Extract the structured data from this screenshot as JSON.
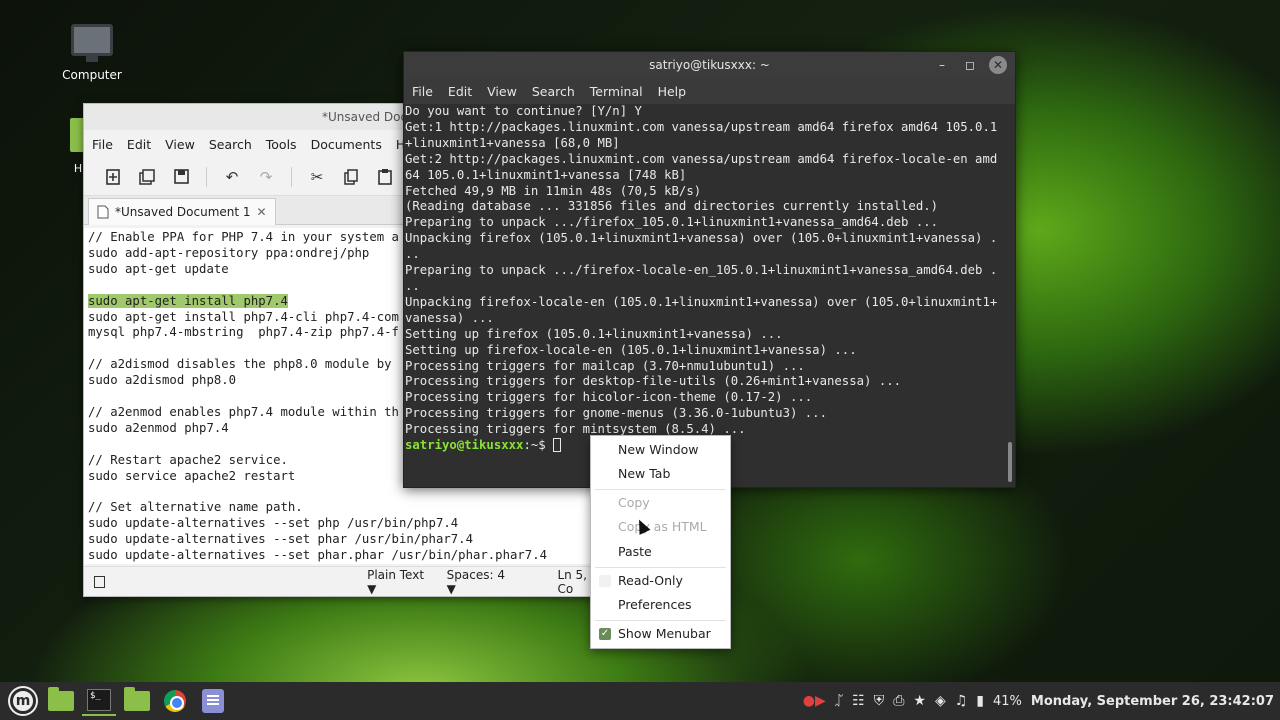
{
  "desktop": {
    "icons": [
      {
        "label": "Computer"
      },
      {
        "label": "H"
      }
    ]
  },
  "editor": {
    "title": "*Unsaved Doc",
    "menu": [
      "File",
      "Edit",
      "View",
      "Search",
      "Tools",
      "Documents",
      "Help"
    ],
    "tab_label": "*Unsaved Document 1",
    "lines": [
      "// Enable PPA for PHP 7.4 in your system a",
      "sudo add-apt-repository ppa:ondrej/php",
      "sudo apt-get update",
      "",
      "sudo apt-get install php7.4",
      "sudo apt-get install php7.4-cli php7.4-com",
      "mysql php7.4-mbstring  php7.4-zip php7.4-f",
      "",
      "// a2dismod disables the php8.0 module by",
      "sudo a2dismod php8.0",
      "",
      "// a2enmod enables php7.4 module within th",
      "sudo a2enmod php7.4",
      "",
      "// Restart apache2 service.",
      "sudo service apache2 restart",
      "",
      "// Set alternative name path.",
      "sudo update-alternatives --set php /usr/bin/php7.4",
      "sudo update-alternatives --set phar /usr/bin/phar7.4",
      "sudo update-alternatives --set phar.phar /usr/bin/phar.phar7.4"
    ],
    "highlighted_line": 4,
    "status": {
      "language": "Plain Text",
      "spaces": "Spaces: 4",
      "position": "Ln 5, Co"
    }
  },
  "terminal": {
    "title": "satriyo@tikusxxx: ~",
    "menu": [
      "File",
      "Edit",
      "View",
      "Search",
      "Terminal",
      "Help"
    ],
    "lines": [
      "Do you want to continue? [Y/n] Y",
      "Get:1 http://packages.linuxmint.com vanessa/upstream amd64 firefox amd64 105.0.1",
      "+linuxmint1+vanessa [68,0 MB]",
      "Get:2 http://packages.linuxmint.com vanessa/upstream amd64 firefox-locale-en amd",
      "64 105.0.1+linuxmint1+vanessa [748 kB]",
      "Fetched 49,9 MB in 11min 48s (70,5 kB/s)",
      "(Reading database ... 331856 files and directories currently installed.)",
      "Preparing to unpack .../firefox_105.0.1+linuxmint1+vanessa_amd64.deb ...",
      "Unpacking firefox (105.0.1+linuxmint1+vanessa) over (105.0+linuxmint1+vanessa) .",
      "..",
      "Preparing to unpack .../firefox-locale-en_105.0.1+linuxmint1+vanessa_amd64.deb .",
      "..",
      "Unpacking firefox-locale-en (105.0.1+linuxmint1+vanessa) over (105.0+linuxmint1+",
      "vanessa) ...",
      "Setting up firefox (105.0.1+linuxmint1+vanessa) ...",
      "Setting up firefox-locale-en (105.0.1+linuxmint1+vanessa) ...",
      "Processing triggers for mailcap (3.70+nmu1ubuntu1) ...",
      "Processing triggers for desktop-file-utils (0.26+mint1+vanessa) ...",
      "Processing triggers for hicolor-icon-theme (0.17-2) ...",
      "Processing triggers for gnome-menus (3.36.0-1ubuntu3) ...",
      "Processing triggers for mintsystem (8.5.4) ..."
    ],
    "prompt_user": "satriyo@tikusxxx",
    "prompt_rest": ":~$ "
  },
  "context_menu": {
    "items": [
      {
        "label": "New Window",
        "enabled": true
      },
      {
        "label": "New Tab",
        "enabled": true
      },
      {
        "label": "Copy",
        "enabled": false
      },
      {
        "label": "Copy as HTML",
        "enabled": false
      },
      {
        "label": "Paste",
        "enabled": true
      },
      {
        "label": "Read-Only",
        "enabled": true
      },
      {
        "label": "Preferences",
        "enabled": true
      },
      {
        "label": "Show Menubar",
        "enabled": true,
        "checked": true
      }
    ]
  },
  "taskbar": {
    "battery": "41%",
    "clock": "Monday, September 26, 23:42:07"
  }
}
